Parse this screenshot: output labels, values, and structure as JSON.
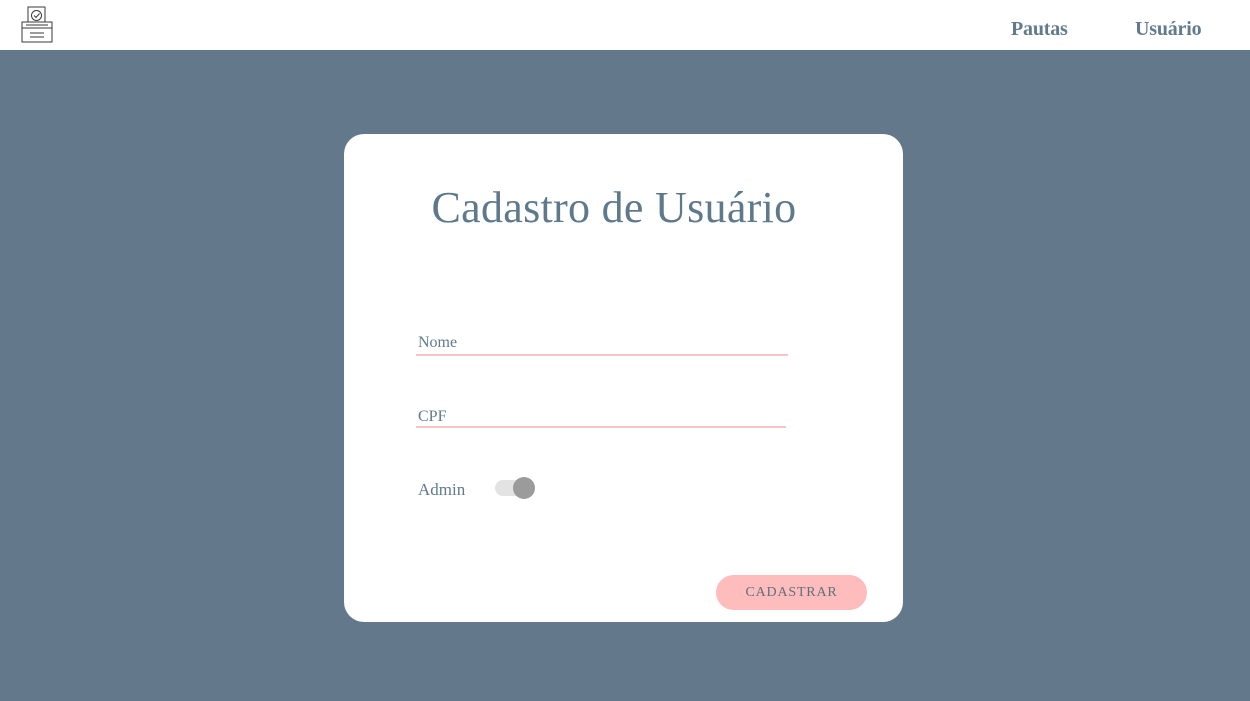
{
  "nav": {
    "logo_icon": "ballot-box-icon",
    "links": [
      {
        "label": "Pautas"
      },
      {
        "label": "Usuário"
      }
    ]
  },
  "form": {
    "title": "Cadastro de Usuário",
    "fields": {
      "nome": {
        "label": "Nome",
        "value": ""
      },
      "cpf": {
        "label": "CPF",
        "value": ""
      }
    },
    "admin": {
      "label": "Admin",
      "checked": false
    },
    "submit_label": "CADASTRAR"
  },
  "colors": {
    "background": "#63798b",
    "text": "#617a8c",
    "accent": "#ffbcbc",
    "underline": "#f7c5c5"
  }
}
